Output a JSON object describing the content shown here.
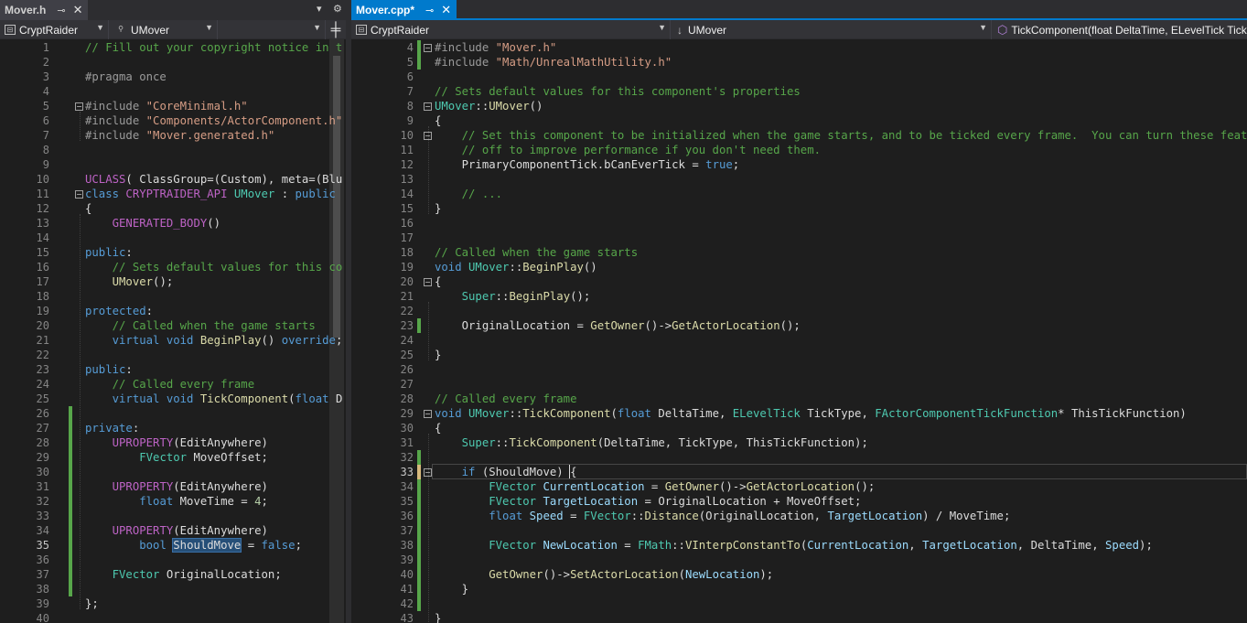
{
  "left": {
    "tab": {
      "name": "Mover.h",
      "pin": "⊸",
      "close": "✕"
    },
    "nav": {
      "project": "CryptRaider",
      "class": "UMover",
      "member": ""
    },
    "lines": [
      [
        {
          "t": "// Fill out your copyright notice in t",
          "c": "cm"
        }
      ],
      [],
      [
        {
          "t": "#pragma once",
          "c": "pp"
        }
      ],
      [],
      [
        {
          "t": "#include ",
          "c": "pp"
        },
        {
          "t": "\"CoreMinimal.h\"",
          "c": "st"
        }
      ],
      [
        {
          "t": "#include ",
          "c": "pp"
        },
        {
          "t": "\"Components/ActorComponent.h\"",
          "c": "st"
        }
      ],
      [
        {
          "t": "#include ",
          "c": "pp"
        },
        {
          "t": "\"Mover.generated.h\"",
          "c": "st"
        }
      ],
      [],
      [],
      [
        {
          "t": "UCLASS",
          "c": "mc"
        },
        {
          "t": "( ClassGroup=(Custom), meta=(Blu",
          "c": "pl"
        }
      ],
      [
        {
          "t": "class ",
          "c": "kw"
        },
        {
          "t": "CRYPTRAIDER_API ",
          "c": "mc"
        },
        {
          "t": "UMover",
          "c": "ty"
        },
        {
          "t": " : ",
          "c": "pl"
        },
        {
          "t": "public",
          "c": "kw"
        }
      ],
      [
        {
          "t": "{",
          "c": "pl"
        }
      ],
      [
        {
          "t": "    ",
          "c": "pl"
        },
        {
          "t": "GENERATED_BODY",
          "c": "mc"
        },
        {
          "t": "()",
          "c": "pl"
        }
      ],
      [],
      [
        {
          "t": "public",
          "c": "kw"
        },
        {
          "t": ":",
          "c": "pl"
        }
      ],
      [
        {
          "t": "    ",
          "c": "pl"
        },
        {
          "t": "// Sets default values for this co",
          "c": "cm"
        }
      ],
      [
        {
          "t": "    ",
          "c": "pl"
        },
        {
          "t": "UMover",
          "c": "fn"
        },
        {
          "t": "();",
          "c": "pl"
        }
      ],
      [],
      [
        {
          "t": "protected",
          "c": "kw"
        },
        {
          "t": ":",
          "c": "pl"
        }
      ],
      [
        {
          "t": "    ",
          "c": "pl"
        },
        {
          "t": "// Called when the game starts",
          "c": "cm"
        }
      ],
      [
        {
          "t": "    ",
          "c": "pl"
        },
        {
          "t": "virtual void ",
          "c": "kw"
        },
        {
          "t": "BeginPlay",
          "c": "fn"
        },
        {
          "t": "() ",
          "c": "pl"
        },
        {
          "t": "override",
          "c": "kw"
        },
        {
          "t": ";",
          "c": "pl"
        }
      ],
      [],
      [
        {
          "t": "public",
          "c": "kw"
        },
        {
          "t": ":",
          "c": "pl"
        }
      ],
      [
        {
          "t": "    ",
          "c": "pl"
        },
        {
          "t": "// Called every frame",
          "c": "cm"
        }
      ],
      [
        {
          "t": "    ",
          "c": "pl"
        },
        {
          "t": "virtual void ",
          "c": "kw"
        },
        {
          "t": "TickComponent",
          "c": "fn"
        },
        {
          "t": "(",
          "c": "pl"
        },
        {
          "t": "float ",
          "c": "kw"
        },
        {
          "t": "D",
          "c": "pl"
        }
      ],
      [],
      [
        {
          "t": "private",
          "c": "kw"
        },
        {
          "t": ":",
          "c": "pl"
        }
      ],
      [
        {
          "t": "    ",
          "c": "pl"
        },
        {
          "t": "UPROPERTY",
          "c": "mc"
        },
        {
          "t": "(EditAnywhere)",
          "c": "pl"
        }
      ],
      [
        {
          "t": "        ",
          "c": "pl"
        },
        {
          "t": "FVector ",
          "c": "ty"
        },
        {
          "t": "MoveOffset;",
          "c": "pl"
        }
      ],
      [],
      [
        {
          "t": "    ",
          "c": "pl"
        },
        {
          "t": "UPROPERTY",
          "c": "mc"
        },
        {
          "t": "(EditAnywhere)",
          "c": "pl"
        }
      ],
      [
        {
          "t": "        ",
          "c": "pl"
        },
        {
          "t": "float ",
          "c": "kw"
        },
        {
          "t": "MoveTime = ",
          "c": "pl"
        },
        {
          "t": "4",
          "c": "nb"
        },
        {
          "t": ";",
          "c": "pl"
        }
      ],
      [],
      [
        {
          "t": "    ",
          "c": "pl"
        },
        {
          "t": "UPROPERTY",
          "c": "mc"
        },
        {
          "t": "(EditAnywhere)",
          "c": "pl"
        }
      ],
      [
        {
          "t": "        ",
          "c": "pl"
        },
        {
          "t": "bool ",
          "c": "kw"
        },
        {
          "t": "ShouldMove",
          "c": "pl",
          "hl": true
        },
        {
          "t": " = ",
          "c": "pl"
        },
        {
          "t": "false",
          "c": "kw"
        },
        {
          "t": ";",
          "c": "pl"
        }
      ],
      [],
      [
        {
          "t": "    ",
          "c": "pl"
        },
        {
          "t": "FVector ",
          "c": "ty"
        },
        {
          "t": "OriginalLocation;",
          "c": "pl"
        }
      ],
      [],
      [
        {
          "t": "};",
          "c": "pl"
        }
      ],
      []
    ]
  },
  "right": {
    "tab": {
      "name": "Mover.cpp*",
      "pin": "⊸",
      "close": "✕"
    },
    "nav": {
      "project": "CryptRaider",
      "class": "UMover",
      "member": "TickComponent(float DeltaTime, ELevelTick Tick"
    },
    "first_line": 4,
    "lines": [
      [
        {
          "t": "#include ",
          "c": "pp"
        },
        {
          "t": "\"Mover.h\"",
          "c": "st"
        }
      ],
      [
        {
          "t": "#include ",
          "c": "pp"
        },
        {
          "t": "\"Math/UnrealMathUtility.h\"",
          "c": "st"
        }
      ],
      [],
      [
        {
          "t": "// Sets default values for this component's properties",
          "c": "cm"
        }
      ],
      [
        {
          "t": "UMover",
          "c": "ty"
        },
        {
          "t": "::",
          "c": "pl"
        },
        {
          "t": "UMover",
          "c": "fn"
        },
        {
          "t": "()",
          "c": "pl"
        }
      ],
      [
        {
          "t": "{",
          "c": "pl"
        }
      ],
      [
        {
          "t": "    ",
          "c": "pl"
        },
        {
          "t": "// Set this component to be initialized when the game starts, and to be ticked every frame.  You can turn these features",
          "c": "cm"
        }
      ],
      [
        {
          "t": "    ",
          "c": "pl"
        },
        {
          "t": "// off to improve performance if you don't need them.",
          "c": "cm"
        }
      ],
      [
        {
          "t": "    ",
          "c": "pl"
        },
        {
          "t": "PrimaryComponentTick",
          "c": "pl"
        },
        {
          "t": ".",
          "c": "pl"
        },
        {
          "t": "bCanEverTick",
          "c": "pl"
        },
        {
          "t": " = ",
          "c": "pl"
        },
        {
          "t": "true",
          "c": "kw"
        },
        {
          "t": ";",
          "c": "pl"
        }
      ],
      [],
      [
        {
          "t": "    ",
          "c": "pl"
        },
        {
          "t": "// ...",
          "c": "cm"
        }
      ],
      [
        {
          "t": "}",
          "c": "pl"
        }
      ],
      [],
      [],
      [
        {
          "t": "// Called when the game starts",
          "c": "cm"
        }
      ],
      [
        {
          "t": "void ",
          "c": "kw"
        },
        {
          "t": "UMover",
          "c": "ty"
        },
        {
          "t": "::",
          "c": "pl"
        },
        {
          "t": "BeginPlay",
          "c": "fn"
        },
        {
          "t": "()",
          "c": "pl"
        }
      ],
      [
        {
          "t": "{",
          "c": "pl"
        }
      ],
      [
        {
          "t": "    ",
          "c": "pl"
        },
        {
          "t": "Super",
          "c": "ty"
        },
        {
          "t": "::",
          "c": "pl"
        },
        {
          "t": "BeginPlay",
          "c": "fn"
        },
        {
          "t": "();",
          "c": "pl"
        }
      ],
      [],
      [
        {
          "t": "    ",
          "c": "pl"
        },
        {
          "t": "OriginalLocation = ",
          "c": "pl"
        },
        {
          "t": "GetOwner",
          "c": "fn"
        },
        {
          "t": "()->",
          "c": "pl"
        },
        {
          "t": "GetActorLocation",
          "c": "fn"
        },
        {
          "t": "();",
          "c": "pl"
        }
      ],
      [],
      [
        {
          "t": "}",
          "c": "pl"
        }
      ],
      [],
      [],
      [
        {
          "t": "// Called every frame",
          "c": "cm"
        }
      ],
      [
        {
          "t": "void ",
          "c": "kw"
        },
        {
          "t": "UMover",
          "c": "ty"
        },
        {
          "t": "::",
          "c": "pl"
        },
        {
          "t": "TickComponent",
          "c": "fn"
        },
        {
          "t": "(",
          "c": "pl"
        },
        {
          "t": "float ",
          "c": "kw"
        },
        {
          "t": "DeltaTime, ",
          "c": "pl"
        },
        {
          "t": "ELevelTick ",
          "c": "ty"
        },
        {
          "t": "TickType, ",
          "c": "pl"
        },
        {
          "t": "FActorComponentTickFunction",
          "c": "ty"
        },
        {
          "t": "* ThisTickFunction)",
          "c": "pl"
        }
      ],
      [
        {
          "t": "{",
          "c": "pl"
        }
      ],
      [
        {
          "t": "    ",
          "c": "pl"
        },
        {
          "t": "Super",
          "c": "ty"
        },
        {
          "t": "::",
          "c": "pl"
        },
        {
          "t": "TickComponent",
          "c": "fn"
        },
        {
          "t": "(DeltaTime, TickType, ThisTickFunction);",
          "c": "pl"
        }
      ],
      [],
      [
        {
          "t": "    ",
          "c": "pl"
        },
        {
          "t": "if ",
          "c": "kw"
        },
        {
          "t": "(ShouldMove) {",
          "c": "pl"
        }
      ],
      [
        {
          "t": "        ",
          "c": "pl"
        },
        {
          "t": "FVector ",
          "c": "ty"
        },
        {
          "t": "CurrentLocation",
          "c": "id"
        },
        {
          "t": " = ",
          "c": "pl"
        },
        {
          "t": "GetOwner",
          "c": "fn"
        },
        {
          "t": "()->",
          "c": "pl"
        },
        {
          "t": "GetActorLocation",
          "c": "fn"
        },
        {
          "t": "();",
          "c": "pl"
        }
      ],
      [
        {
          "t": "        ",
          "c": "pl"
        },
        {
          "t": "FVector ",
          "c": "ty"
        },
        {
          "t": "TargetLocation",
          "c": "id"
        },
        {
          "t": " = OriginalLocation + MoveOffset;",
          "c": "pl"
        }
      ],
      [
        {
          "t": "        ",
          "c": "pl"
        },
        {
          "t": "float ",
          "c": "kw"
        },
        {
          "t": "Speed",
          "c": "id"
        },
        {
          "t": " = ",
          "c": "pl"
        },
        {
          "t": "FVector",
          "c": "ty"
        },
        {
          "t": "::",
          "c": "pl"
        },
        {
          "t": "Distance",
          "c": "fn"
        },
        {
          "t": "(OriginalLocation, ",
          "c": "pl"
        },
        {
          "t": "TargetLocation",
          "c": "id"
        },
        {
          "t": ") / MoveTime;",
          "c": "pl"
        }
      ],
      [],
      [
        {
          "t": "        ",
          "c": "pl"
        },
        {
          "t": "FVector ",
          "c": "ty"
        },
        {
          "t": "NewLocation",
          "c": "id"
        },
        {
          "t": " = ",
          "c": "pl"
        },
        {
          "t": "FMath",
          "c": "ty"
        },
        {
          "t": "::",
          "c": "pl"
        },
        {
          "t": "VInterpConstantTo",
          "c": "fn"
        },
        {
          "t": "(",
          "c": "pl"
        },
        {
          "t": "CurrentLocation",
          "c": "id"
        },
        {
          "t": ", ",
          "c": "pl"
        },
        {
          "t": "TargetLocation",
          "c": "id"
        },
        {
          "t": ", DeltaTime, ",
          "c": "pl"
        },
        {
          "t": "Speed",
          "c": "id"
        },
        {
          "t": ");",
          "c": "pl"
        }
      ],
      [],
      [
        {
          "t": "        ",
          "c": "pl"
        },
        {
          "t": "GetOwner",
          "c": "fn"
        },
        {
          "t": "()->",
          "c": "pl"
        },
        {
          "t": "SetActorLocation",
          "c": "fn"
        },
        {
          "t": "(",
          "c": "pl"
        },
        {
          "t": "NewLocation",
          "c": "id"
        },
        {
          "t": ");",
          "c": "pl"
        }
      ],
      [
        {
          "t": "    ",
          "c": "pl"
        },
        {
          "t": "}",
          "c": "pl"
        }
      ],
      [],
      [
        {
          "t": "}",
          "c": "pl"
        }
      ]
    ]
  },
  "right_current_line": 33,
  "left_current_line": 35
}
